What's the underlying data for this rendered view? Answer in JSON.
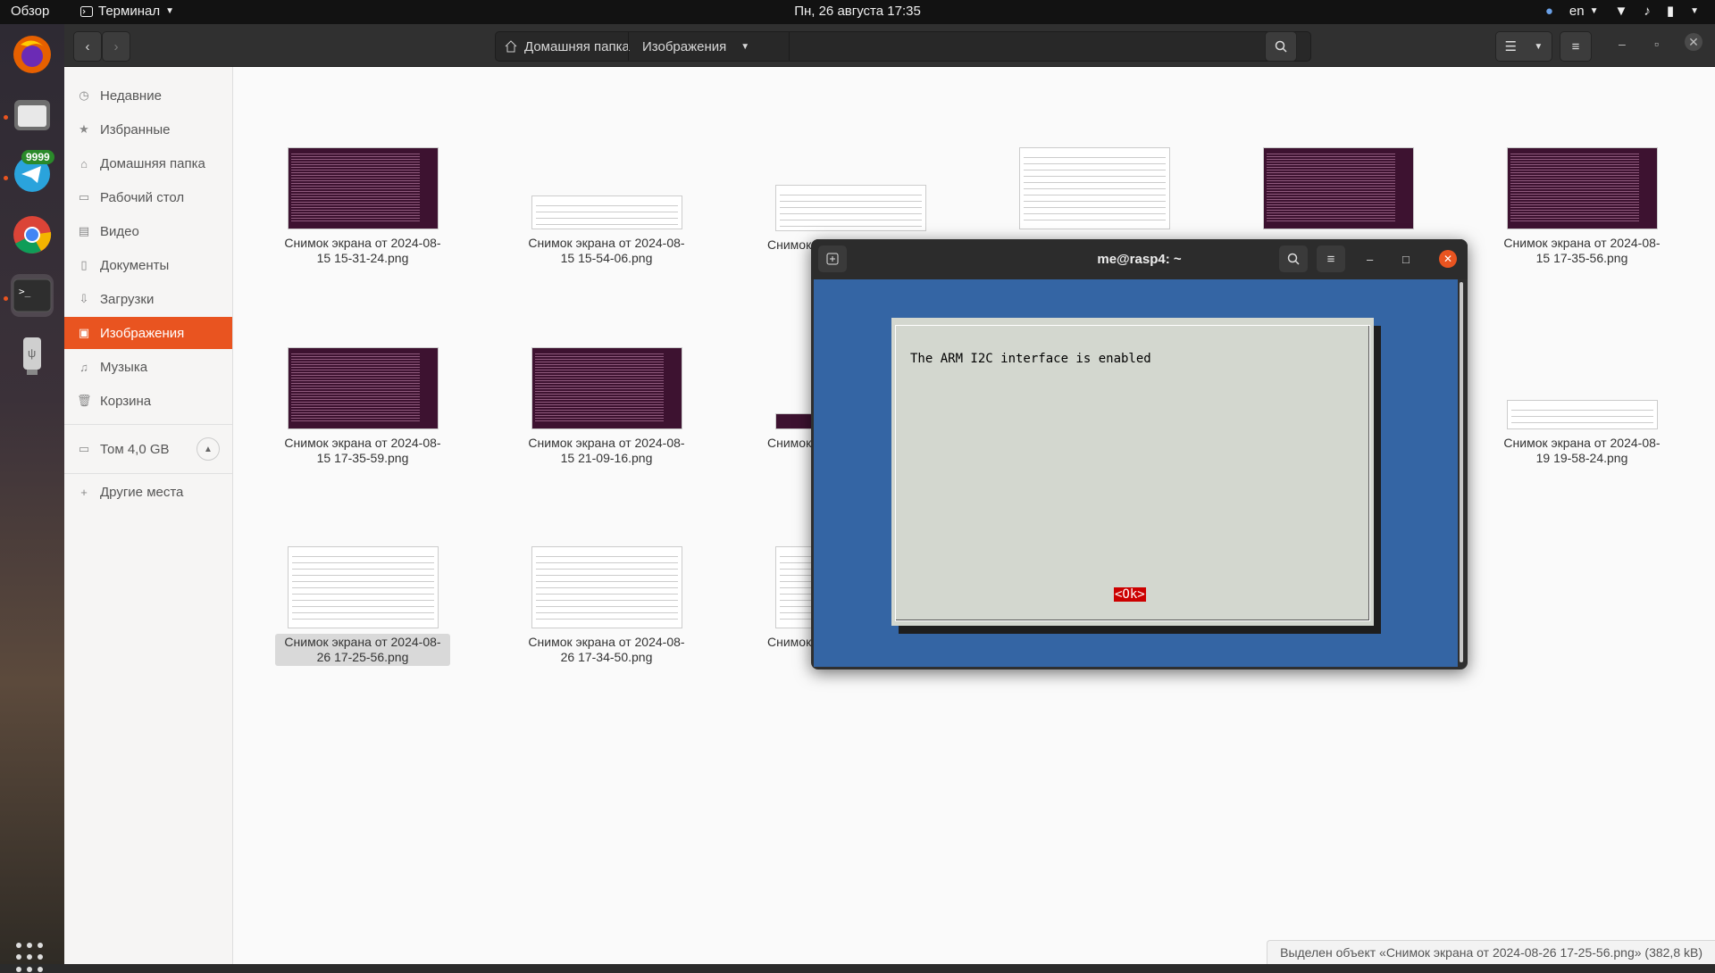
{
  "topbar": {
    "overview": "Обзор",
    "app_menu": "Терминал",
    "clock": "Пн, 26 августа  17:35",
    "language": "en"
  },
  "dock": {
    "telegram_badge": "9999"
  },
  "files": {
    "path": [
      "Домашняя папка",
      "Изображения"
    ],
    "sidebar": {
      "items": [
        "Недавние",
        "Избранные",
        "Домашняя папка",
        "Рабочий стол",
        "Видео",
        "Документы",
        "Загрузки",
        "Изображения",
        "Музыка",
        "Корзина"
      ],
      "volume": "Том 4,0 GB",
      "other": "Другие места"
    },
    "thumbnails": [
      {
        "line1": "Снимок экрана от 2024-08-",
        "line2": "15 15-31-24.png"
      },
      {
        "line1": "Снимок экрана от 2024-08-",
        "line2": "15 15-54-06.png"
      },
      {
        "line1": "Снимок экрана от 2024-08-",
        "line2": "15 17-35-56.png"
      },
      {
        "line1": "Снимок экрана от 2024-08-",
        "line2": "15 17-35-59.png"
      },
      {
        "line1": "Снимок экрана от 2024-08-",
        "line2": "15 21-09-16.png"
      },
      {
        "line1": "Снимок экрана от 2024-08-",
        "line2": "19 19-58-24.png"
      },
      {
        "line1": "Снимок экрана от 2024-08-",
        "line2": "26 17-25-56.png"
      },
      {
        "line1": "Снимок экрана от 2024-08-",
        "line2": "26 17-34-50.png"
      }
    ],
    "partial_labels": [
      "Снимок",
      "Снимок",
      "Снимок"
    ],
    "status": "Выделен объект «Снимок экрана от 2024-08-26 17-25-56.png» (382,8 kB)"
  },
  "terminal": {
    "title": "me@rasp4: ~",
    "message": "The ARM I2C interface is enabled",
    "ok": "<Ok>"
  },
  "colors": {
    "accent": "#e95420",
    "terminal_bg": "#3465a4",
    "dialog_bg": "#d3d7cf",
    "ok_bg": "#cc0000"
  }
}
